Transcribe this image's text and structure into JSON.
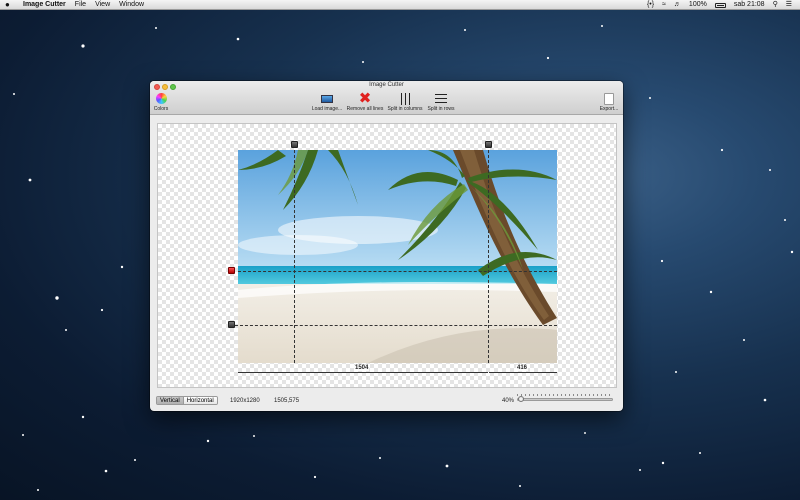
{
  "menubar": {
    "app_name": "Image Cutter",
    "menus": [
      "File",
      "View",
      "Window"
    ],
    "status_text": "{•}",
    "battery": "100%",
    "clock": "sab 21:08",
    "icons": [
      "apple-icon",
      "wifi-icon",
      "volume-icon",
      "battery-icon",
      "search-icon",
      "list-icon"
    ]
  },
  "window": {
    "title": "Image Cutter",
    "toolbar": {
      "colors": "Colors",
      "load": "Load image...",
      "remove": "Remove all lines",
      "split_columns": "Split in columns",
      "split_rows": "Split in rows",
      "export": "Export..."
    },
    "canvas": {
      "measure_left": "1504",
      "measure_right": "416"
    },
    "bottom": {
      "seg_vertical": "Vertical",
      "seg_horizontal": "Horizontal",
      "image_size": "1920x1280",
      "cursor": "1505,575",
      "zoom": "40%",
      "zoom_fraction": 0.04
    }
  },
  "colors": {
    "close": "#f25a52",
    "minimize": "#f6bd3b",
    "maximize": "#5fc64b",
    "remove_x": "#e0211f",
    "red_handle": "#d01010"
  }
}
